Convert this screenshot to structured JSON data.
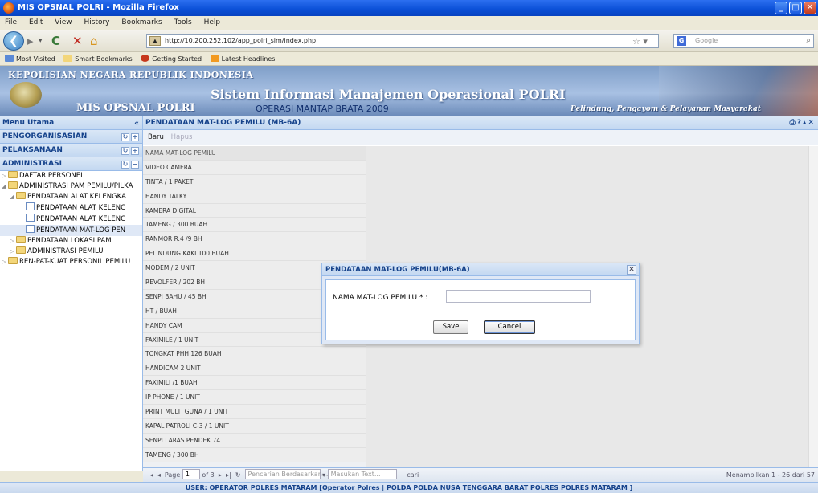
{
  "window": {
    "title": "MIS OPSNAL POLRI - Mozilla Firefox"
  },
  "menu": [
    "File",
    "Edit",
    "View",
    "History",
    "Bookmarks",
    "Tools",
    "Help"
  ],
  "nav": {
    "url": "http://10.200.252.102/app_polri_sim/index.php",
    "search_placeholder": "Google"
  },
  "bookmarks": [
    "Most Visited",
    "Smart Bookmarks",
    "Getting Started",
    "Latest Headlines"
  ],
  "banner": {
    "org": "KEPOLISIAN NEGARA REPUBLIK INDONESIA",
    "app": "MIS OPSNAL POLRI",
    "system": "Sistem Informasi Manajemen Operasional POLRI",
    "operation": "OPERASI MANTAP BRATA 2009",
    "tagline": "Pelindung, Pengayom & Pelayanan Masyarakat"
  },
  "left": {
    "menu_title": "Menu Utama",
    "sections": [
      "PENGORGANISASIAN",
      "PELAKSANAAN",
      "ADMINISTRASI"
    ],
    "tree": [
      "DAFTAR PERSONEL",
      "ADMINISTRASI PAM PEMILU/PILKA",
      "PENDATAAN ALAT KELENGKA",
      "PENDATAAN ALAT KELENC",
      "PENDATAAN ALAT KELENC",
      "PENDATAAN MAT-LOG PEN",
      "PENDATAAN LOKASI PAM",
      "ADMINISTRASI PEMILU",
      "REN-PAT-KUAT PERSONIL PEMILU"
    ]
  },
  "main": {
    "title": "PENDATAAN MAT-LOG PEMILU (MB-6A)",
    "toolbar": {
      "new": "Baru",
      "delete": "Hapus"
    },
    "column_header": "NAMA MAT-LOG PEMILU",
    "rows": [
      "VIDEO CAMERA",
      "TINTA / 1 PAKET",
      "HANDY TALKY",
      "KAMERA DIGITAL",
      "TAMENG / 300 BUAH",
      "RANMOR R.4 /9 BH",
      "PELINDUNG KAKI 100 BUAH",
      "MODEM / 2 UNIT",
      "REVOLFER / 202 BH",
      "SENPI BAHU / 45 BH",
      "HT / BUAH",
      "HANDY CAM",
      "FAXIMILE / 1 UNIT",
      "TONGKAT PHH 126 BUAH",
      "HANDICAM 2 UNIT",
      "FAXIMILI /1 BUAH",
      "IP PHONE / 1 UNIT",
      "PRINT MULTI GUNA / 1 UNIT",
      "KAPAL PATROLI C-3 / 1 UNIT",
      "SENPI LARAS PENDEK 74",
      "TAMENG / 300 BH"
    ],
    "pager": {
      "page_label": "Page",
      "page": "1",
      "of": "of 3",
      "search_by": "Pencarian Berdasarkan...",
      "search_text": "Masukan Text...",
      "search_btn": "cari",
      "display": "Menampilkan 1 - 26 dari 57"
    }
  },
  "dialog": {
    "title": "PENDATAAN MAT-LOG PEMILU(MB-6A)",
    "field_label": "NAMA MAT-LOG PEMILU * :",
    "field_value": "",
    "save": "Save",
    "cancel": "Cancel"
  },
  "status": {
    "user": "USER: OPERATOR POLRES MATARAM [Operator Polres | POLDA POLDA NUSA TENGGARA BARAT POLRES POLRES MATARAM ]"
  }
}
